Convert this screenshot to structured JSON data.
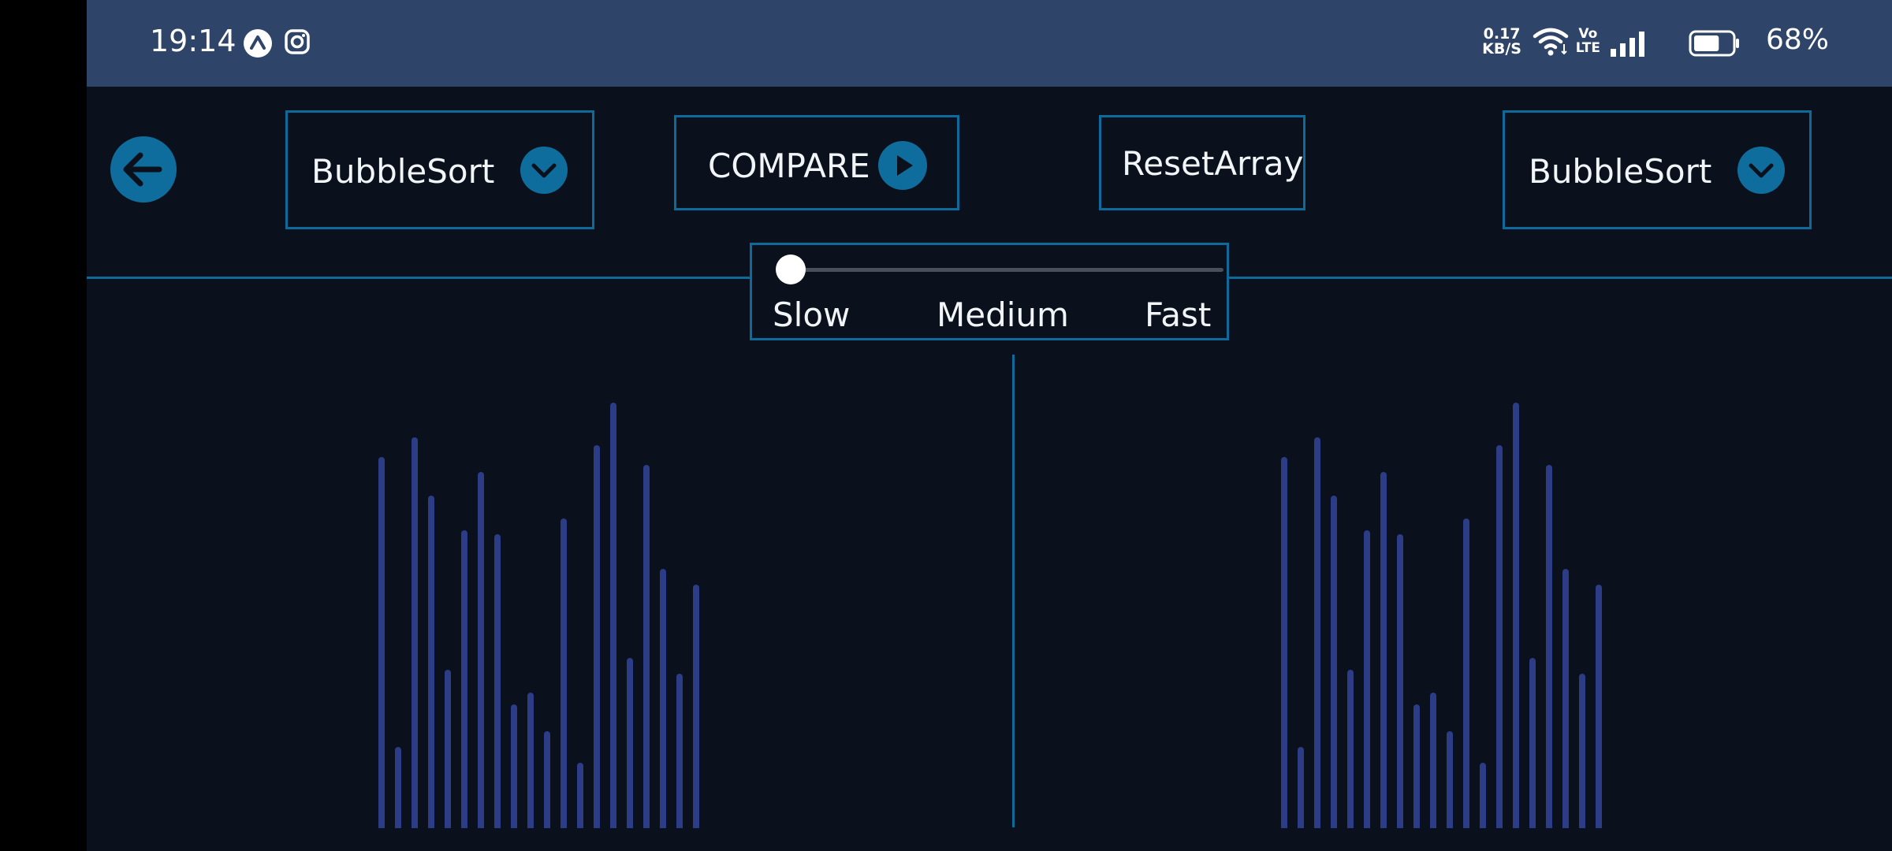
{
  "status_bar": {
    "time": "19:14",
    "icons": [
      "app-icon",
      "instagram-icon"
    ],
    "net_speed_value": "0.17",
    "net_speed_unit": "KB/S",
    "volte_top": "Vo",
    "volte_bottom": "LTE",
    "battery_percent": "68%",
    "battery_level": 0.68
  },
  "toolbar": {
    "back_icon": "arrow-left-icon",
    "left_algorithm": "BubbleSort",
    "compare_label": "COMPARE",
    "reset_label": "ResetArray",
    "right_algorithm": "BubbleSort"
  },
  "speed": {
    "labels": [
      "Slow",
      "Medium",
      "Fast"
    ],
    "value": 0.0
  },
  "array": {
    "values": [
      96,
      21,
      101,
      86,
      41,
      77,
      92,
      76,
      32,
      35,
      25,
      80,
      17,
      99,
      110,
      44,
      94,
      67,
      40,
      63
    ],
    "max": 110
  },
  "colors": {
    "accent": "#0f6d9d",
    "bar": "#2d3c86",
    "background": "#0b111c",
    "status_bar": "#2e4468"
  }
}
